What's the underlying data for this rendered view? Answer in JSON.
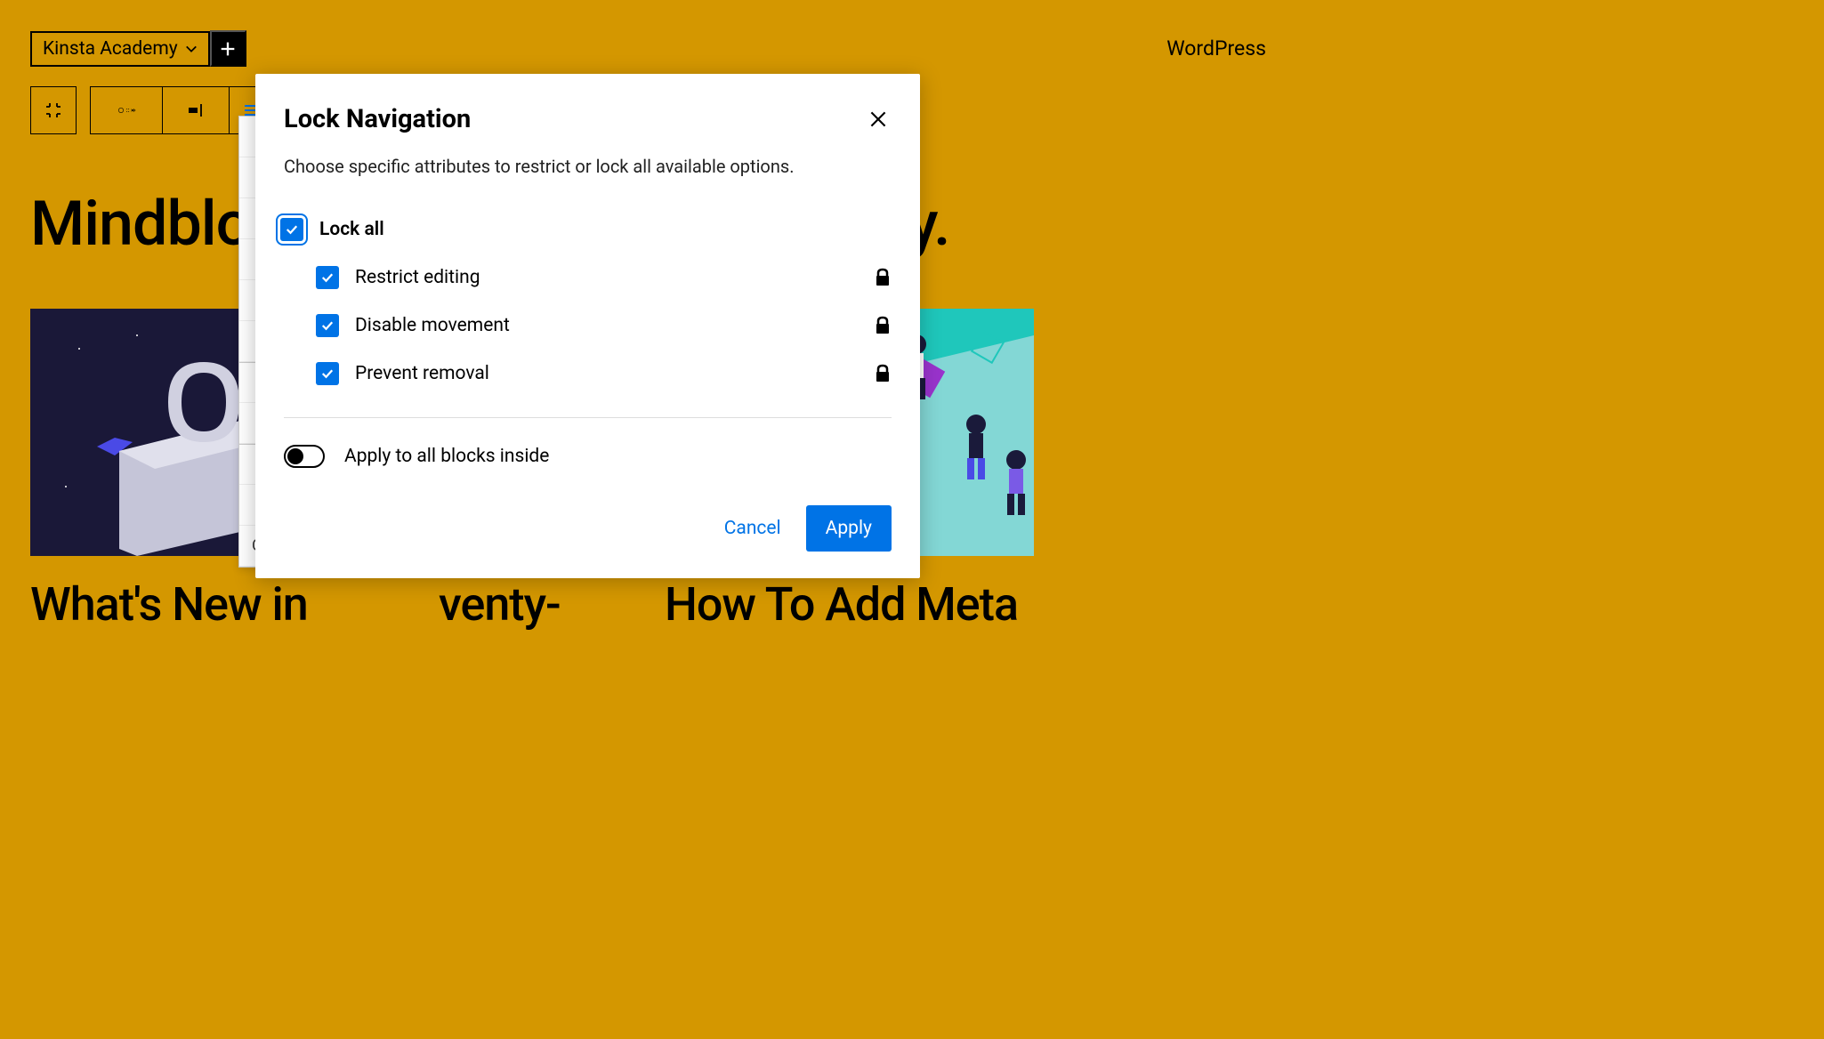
{
  "nav": {
    "dropdown_label": "Kinsta Academy",
    "brand": "WordPress"
  },
  "page": {
    "heading_visible": "Mindblown:",
    "heading_partial1": "hilosophy.",
    "heading_partial2": "venty-"
  },
  "posts": {
    "p1_title": "What's New in",
    "p3_title": "How To Add Meta"
  },
  "menu": {
    "reusable": "Create Reusable block"
  },
  "modal": {
    "title": "Lock Navigation",
    "desc": "Choose specific attributes to restrict or lock all available options.",
    "lock_all": "Lock all",
    "restrict": "Restrict editing",
    "disable": "Disable movement",
    "prevent": "Prevent removal",
    "apply_inside": "Apply to all blocks inside",
    "cancel": "Cancel",
    "apply": "Apply"
  }
}
